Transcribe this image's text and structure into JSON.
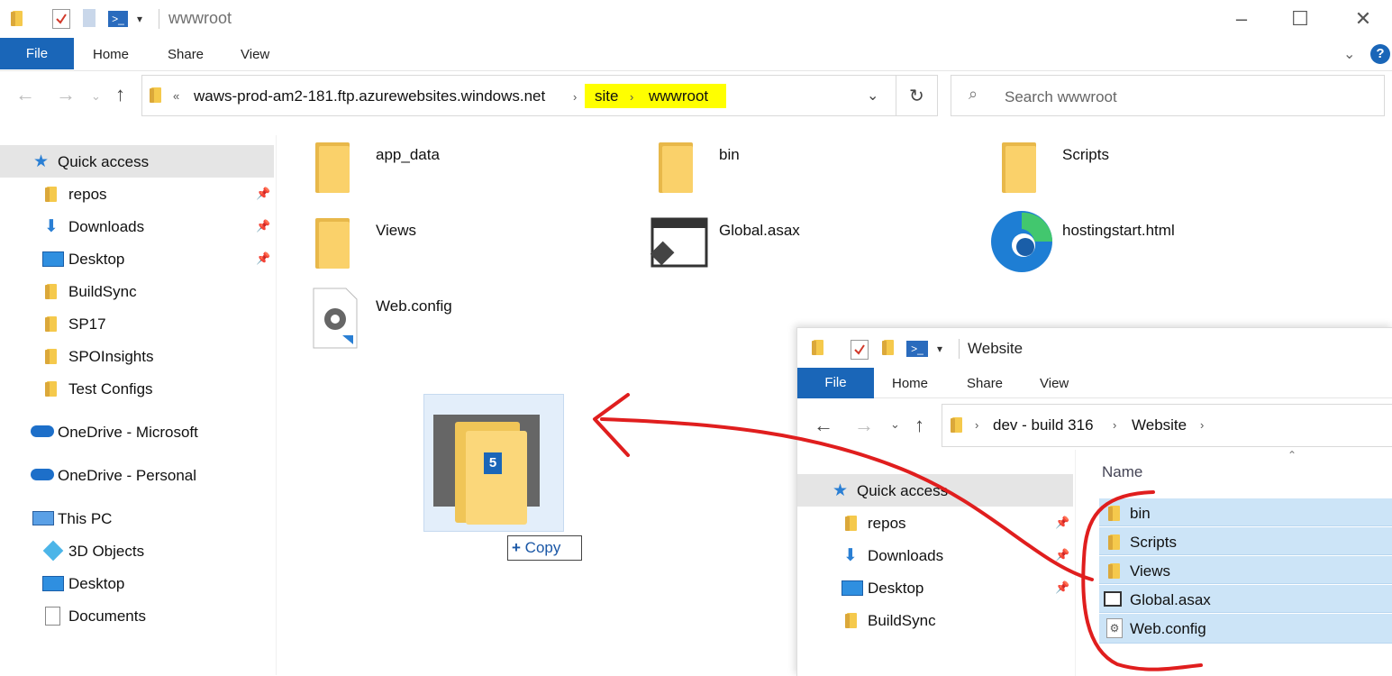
{
  "main_window": {
    "title": "wwwroot",
    "ribbon_tabs": {
      "file": "File",
      "home": "Home",
      "share": "Share",
      "view": "View"
    },
    "address": {
      "overflow": "«",
      "crumbs": [
        "waws-prod-am2-181.ftp.azurewebsites.windows.net",
        "site",
        "wwwroot"
      ],
      "highlight_color": "#ffff00"
    },
    "search_placeholder": "Search wwwroot",
    "sidebar": {
      "quick_access": "Quick access",
      "items": [
        "repos",
        "Downloads",
        "Desktop",
        "BuildSync",
        "SP17",
        "SPOInsights",
        "Test Configs"
      ],
      "onedrive_microsoft": "OneDrive - Microsoft",
      "onedrive_personal": "OneDrive - Personal",
      "this_pc": "This PC",
      "pc_items": [
        "3D Objects",
        "Desktop",
        "Documents"
      ]
    },
    "files": [
      "app_data",
      "bin",
      "Scripts",
      "Views",
      "Global.asax",
      "hostingstart.html",
      "Web.config"
    ]
  },
  "drag": {
    "count": "5",
    "copy_label": "Copy"
  },
  "second_window": {
    "title": "Website",
    "ribbon_tabs": {
      "file": "File",
      "home": "Home",
      "share": "Share",
      "view": "View"
    },
    "crumbs": [
      "dev - build 316",
      "Website"
    ],
    "column_header": "Name",
    "sidebar": {
      "quick_access": "Quick access",
      "items": [
        "repos",
        "Downloads",
        "Desktop",
        "BuildSync"
      ]
    },
    "selected_files": [
      "bin",
      "Scripts",
      "Views",
      "Global.asax",
      "Web.config"
    ]
  },
  "colors": {
    "accent": "#1a66b8",
    "selection": "#cce4f7",
    "annotation": "#e01e1e"
  }
}
